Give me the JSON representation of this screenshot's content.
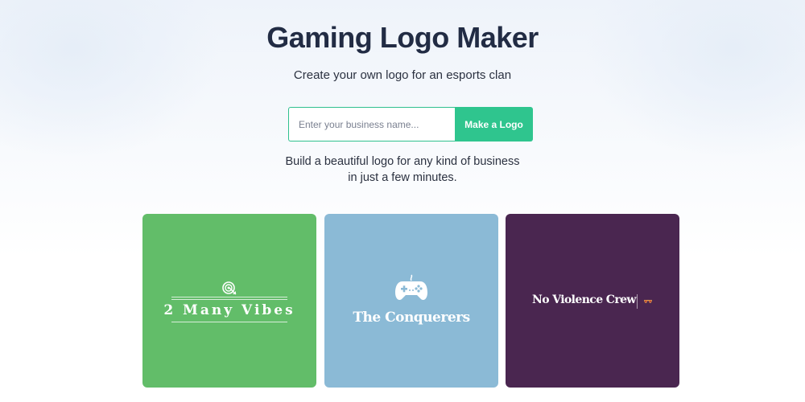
{
  "hero": {
    "title": "Gaming Logo Maker",
    "subtitle": "Create your own logo for an esports clan",
    "input_placeholder": "Enter your business name...",
    "button_label": "Make a Logo",
    "description_line1": "Build a beautiful logo for any kind of business",
    "description_line2": "in just a few minutes."
  },
  "colors": {
    "accent": "#2fc58e",
    "title": "#222c44",
    "card_green": "#62bd69",
    "card_blue": "#8bbad6",
    "card_purple": "#4a2650"
  },
  "examples": [
    {
      "name": "2 Many Vibes",
      "icon": "target-arrow-icon"
    },
    {
      "name": "The Conquerers",
      "icon": "gamepad-icon"
    },
    {
      "name": "No Violence Crew",
      "icon": "glasses-icon"
    }
  ]
}
